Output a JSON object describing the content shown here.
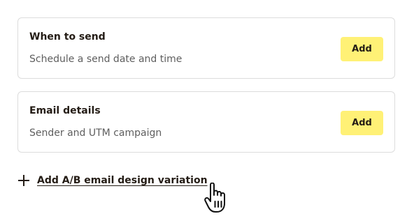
{
  "cards": [
    {
      "title": "When to send",
      "description": "Schedule a send date and time",
      "button_label": "Add"
    },
    {
      "title": "Email details",
      "description": "Sender and UTM campaign",
      "button_label": "Add"
    }
  ],
  "ab_link": {
    "icon": "plus-icon",
    "label": "Add A/B email design variation"
  },
  "cursor": {
    "icon": "hand-pointer-icon"
  },
  "colors": {
    "button_bg": "#fff176",
    "text": "#241c15",
    "muted_text": "#5e5e5e",
    "border": "#dcdcdc"
  }
}
